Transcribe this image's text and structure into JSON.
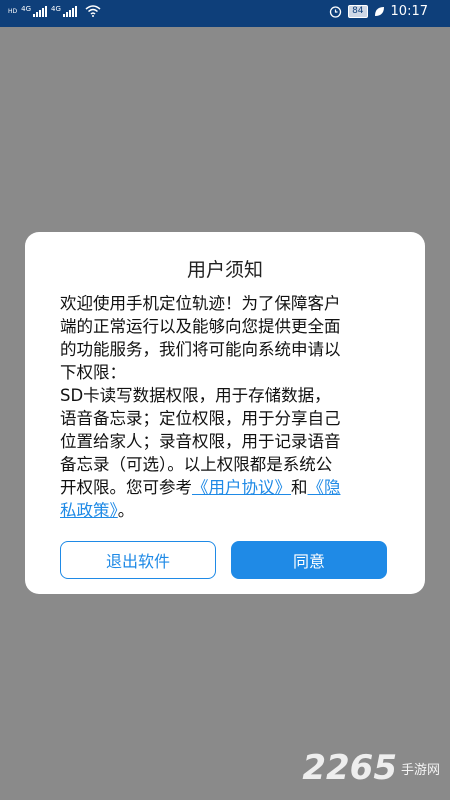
{
  "status_bar": {
    "sim1_tag": "HD",
    "sim2_tag": "HD",
    "net1": "4G",
    "net2": "4G",
    "battery": "84",
    "time": "10:17",
    "icons": [
      "signal-icon",
      "wifi-icon",
      "alarm-icon",
      "battery-icon",
      "leaf-icon"
    ]
  },
  "dialog": {
    "title": "用户须知",
    "body_lines": [
      "欢迎使用手机定位轨迹！为了保障客户",
      "端的正常运行以及能够向您提供更全面",
      "的功能服务，我们将可能向系统申请以",
      "下权限：",
      "SD卡读写数据权限，用于存储数据，",
      "语音备忘录；定位权限，用于分享自己",
      "位置给家人；录音权限，用于记录语音",
      "备忘录（可选）。以上权限都是系统公"
    ],
    "last_line_prefix": "开权限。您可参考",
    "user_agreement_link": "《用户协议》",
    "and_text": "和",
    "privacy_link_part1": "《隐",
    "privacy_link_part2": "私政策》",
    "end_punct": "。",
    "exit_button": "退出软件",
    "agree_button": "同意"
  },
  "watermark": {
    "digits": "2265",
    "text": "手游网"
  },
  "colors": {
    "status_bar": "#0e3f7a",
    "overlay": "#8a8a8a",
    "accent": "#1f8ae6"
  }
}
